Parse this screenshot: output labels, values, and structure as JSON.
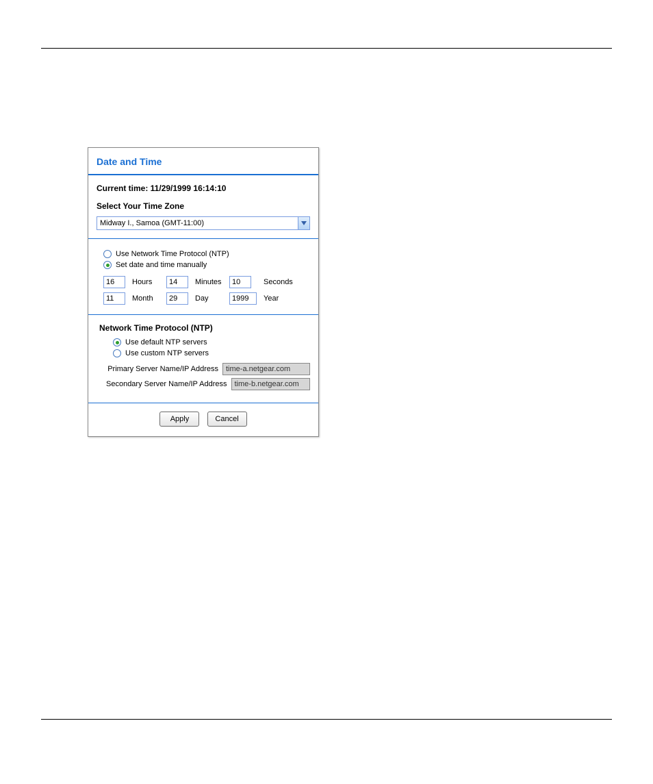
{
  "title": "Date and Time",
  "current_time_label": "Current time: 11/29/1999 16:14:10",
  "tz_heading": "Select Your Time Zone",
  "tz_selected": "Midway I., Samoa (GMT-11:00)",
  "mode": {
    "ntp_label": "Use Network Time Protocol (NTP)",
    "manual_label": "Set date and time manually"
  },
  "manual": {
    "hours": "16",
    "hours_label": "Hours",
    "minutes": "14",
    "minutes_label": "Minutes",
    "seconds": "10",
    "seconds_label": "Seconds",
    "month": "11",
    "month_label": "Month",
    "day": "29",
    "day_label": "Day",
    "year": "1999",
    "year_label": "Year"
  },
  "ntp": {
    "heading": "Network Time Protocol (NTP)",
    "default_label": "Use default NTP servers",
    "custom_label": "Use custom NTP servers",
    "primary_label": "Primary Server Name/IP Address",
    "primary_value": "time-a.netgear.com",
    "secondary_label": "Secondary Server Name/IP Address",
    "secondary_value": "time-b.netgear.com"
  },
  "buttons": {
    "apply": "Apply",
    "cancel": "Cancel"
  }
}
